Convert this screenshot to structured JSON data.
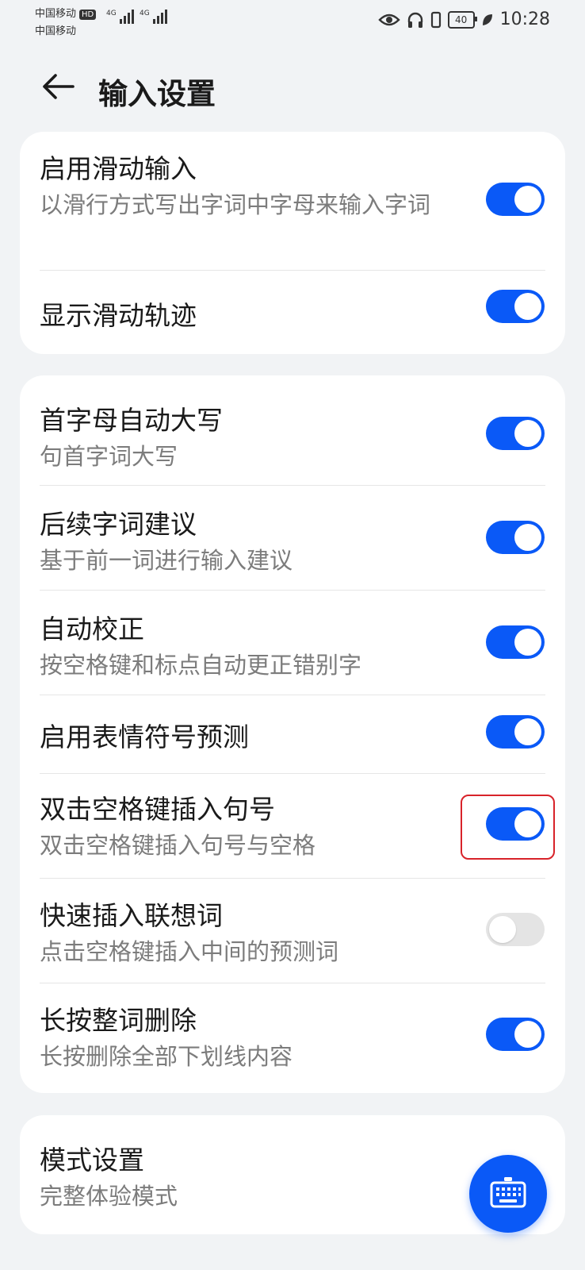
{
  "status_bar": {
    "carrier1": "中国移动",
    "carrier2": "中国移动",
    "hd_badge": "HD",
    "signal1_label": "4G",
    "signal2_label": "4G",
    "battery": "40",
    "time": "10:28"
  },
  "header": {
    "title": "输入设置"
  },
  "group1": [
    {
      "title": "启用滑动输入",
      "subtitle": "以滑行方式写出字词中字母来输入字词",
      "enabled": true
    },
    {
      "title": "显示滑动轨迹",
      "subtitle": "",
      "enabled": true
    }
  ],
  "group2": [
    {
      "title": "首字母自动大写",
      "subtitle": "句首字词大写",
      "enabled": true
    },
    {
      "title": "后续字词建议",
      "subtitle": "基于前一词进行输入建议",
      "enabled": true
    },
    {
      "title": "自动校正",
      "subtitle": "按空格键和标点自动更正错别字",
      "enabled": true
    },
    {
      "title": "启用表情符号预测",
      "subtitle": "",
      "enabled": true
    },
    {
      "title": "双击空格键插入句号",
      "subtitle": "双击空格键插入句号与空格",
      "enabled": true
    },
    {
      "title": "快速插入联想词",
      "subtitle": "点击空格键插入中间的预测词",
      "enabled": false
    },
    {
      "title": "长按整词删除",
      "subtitle": "长按删除全部下划线内容",
      "enabled": true
    }
  ],
  "group3": [
    {
      "title": "模式设置",
      "subtitle": "完整体验模式"
    }
  ],
  "fab_icon": "keyboard-icon",
  "colors": {
    "accent": "#0a59f7",
    "background": "#f1f3f5",
    "highlight": "#d8232a"
  }
}
